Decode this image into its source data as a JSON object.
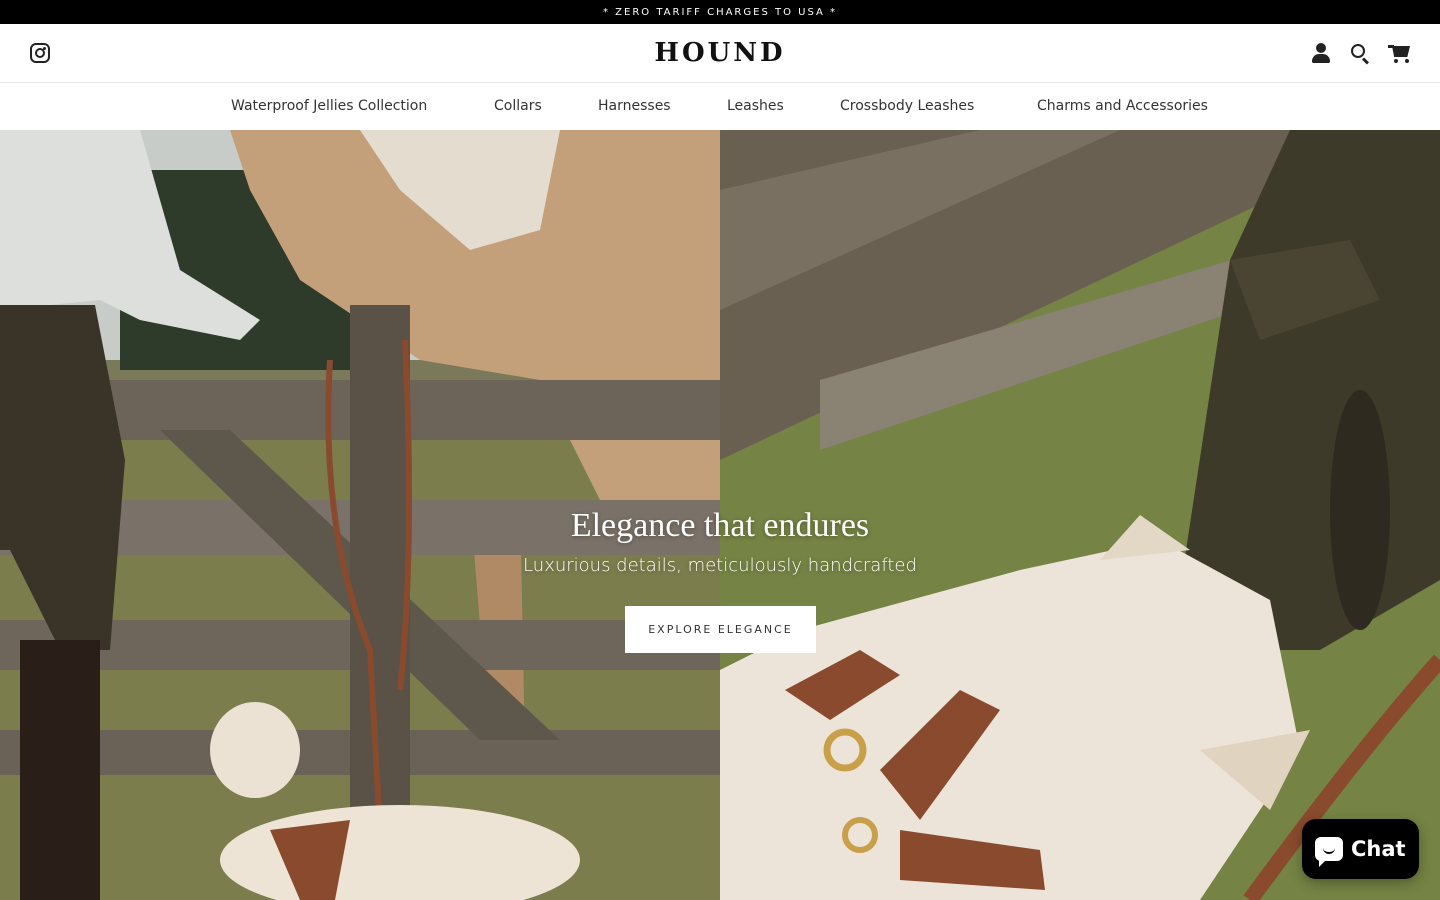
{
  "announcement": {
    "text": "* ZERO TARIFF CHARGES TO USA *"
  },
  "header": {
    "logo": "HOUND",
    "icons": {
      "social": "instagram-icon",
      "account": "user-icon",
      "search": "search-icon",
      "cart": "cart-icon"
    }
  },
  "nav": {
    "items": [
      {
        "label": "Waterproof Jellies Collection"
      },
      {
        "label": "Collars"
      },
      {
        "label": "Harnesses"
      },
      {
        "label": "Leashes"
      },
      {
        "label": "Crossbody Leashes"
      },
      {
        "label": "Charms and Accessories"
      }
    ]
  },
  "hero": {
    "title": "Elegance that endures",
    "subtitle": "Luxurious details, meticulously handcrafted",
    "cta": "EXPLORE ELEGANCE"
  },
  "chat": {
    "label": "Chat",
    "icon": "chat-bubble-icon"
  },
  "colors": {
    "announcement_bg": "#000000",
    "leather": "#8a4a2e",
    "brass": "#c9a04a"
  }
}
